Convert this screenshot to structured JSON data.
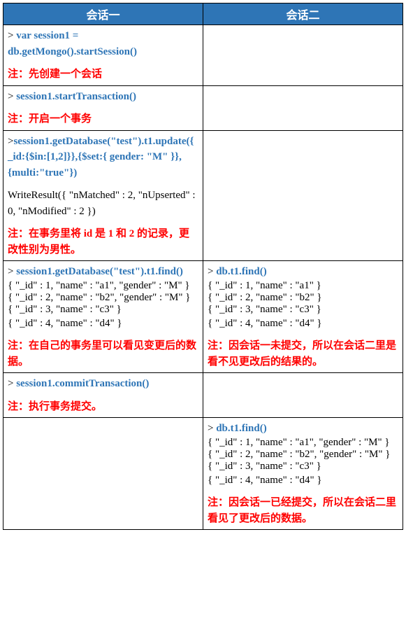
{
  "headers": {
    "col1": "会话一",
    "col2": "会话二"
  },
  "rows": [
    {
      "c1": {
        "cmd": "var session1 = db.getMongo().startSession()",
        "note": "注：先创建一个会话"
      },
      "c2": null
    },
    {
      "c1": {
        "cmd": "session1.startTransaction()",
        "note": "注：开启一个事务"
      },
      "c2": null
    },
    {
      "c1": {
        "cmd_nogt": "session1.getDatabase(\"test\").t1.update({_id:{$in:[1,2]}},{$set:{ gender: \"M\" }},{multi:\"true\"})",
        "output": "WriteResult({ \"nMatched\" : 2,     \"nUpserted\" : 0, \"nModified\" : 2 })",
        "note": "注：在事务里将 id 是 1 和 2 的记录，更改性别为男性。"
      },
      "c2": null
    },
    {
      "c1": {
        "cmd": "session1.getDatabase(\"test\").t1.find()",
        "results": [
          "{ \"_id\" : 1, \"name\" : \"a1\", \"gender\" : \"M\" }",
          "{ \"_id\" : 2, \"name\" : \"b2\", \"gender\" : \"M\" }",
          "{ \"_id\" : 3, \"name\" : \"c3\" }",
          "{ \"_id\" : 4, \"name\" : \"d4\" }"
        ],
        "note": "注：在自己的事务里可以看见变更后的数据。"
      },
      "c2": {
        "cmd": "db.t1.find()",
        "results": [
          "{ \"_id\" : 1, \"name\" : \"a1\" }",
          "{ \"_id\" : 2, \"name\" : \"b2\" }",
          "{ \"_id\" : 3, \"name\" : \"c3\" }",
          "{ \"_id\" : 4, \"name\" : \"d4\" }"
        ],
        "note": "注：因会话一未提交，所以在会话二里是看不见更改后的结果的。"
      }
    },
    {
      "c1": {
        "cmd": "session1.commitTransaction()",
        "note": "注：执行事务提交。"
      },
      "c2": null
    },
    {
      "c1": null,
      "c2": {
        "cmd": "db.t1.find()",
        "results": [
          "{ \"_id\" : 1, \"name\" : \"a1\", \"gender\" : \"M\" }",
          "{ \"_id\" : 2, \"name\" : \"b2\", \"gender\" : \"M\" }",
          "{ \"_id\" : 3, \"name\" : \"c3\" }",
          "{ \"_id\" : 4, \"name\" : \"d4\" }"
        ],
        "note": "注：因会话一已经提交，所以在会话二里看见了更改后的数据。"
      }
    }
  ]
}
